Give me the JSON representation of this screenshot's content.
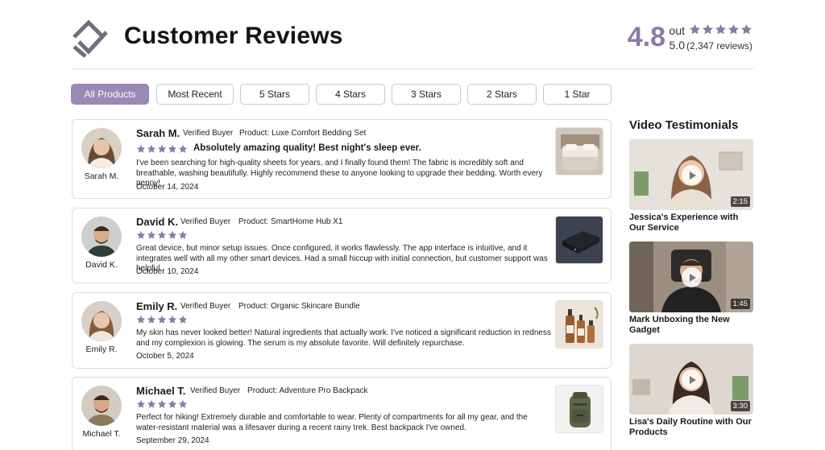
{
  "header": {
    "title": "Customer Reviews",
    "rating": "4.8",
    "rating_out": "out",
    "rating_of": "5.0",
    "rating_count": "(2,347 reviews)",
    "accent_color": "#8c7aa8"
  },
  "filters": [
    "All Products",
    "Most Recent",
    "5 Stars",
    "4 Stars",
    "3 Stars",
    "2 Stars",
    "1 Star"
  ],
  "active_filter": "All Products",
  "reviews": [
    {
      "name": "Sarah M.",
      "avatar_label": "Sarah M.",
      "verified": "Verified Buyer",
      "product": "Product: Luxe Comfort Bedding Set",
      "stars": 5,
      "headline": "Absolutely amazing quality! Best night's sleep ever.",
      "body": "I've been searching for high-quality sheets for years, and I finally found them! The fabric is incredibly soft and breathable, washing beautifully. Highly recommend these to anyone looking to upgrade their bedding. Worth every penny!",
      "date": "October 14, 2024",
      "thumb_icon": "bedding-image"
    },
    {
      "name": "David K.",
      "avatar_label": "David K.",
      "verified": "Verified Buyer",
      "product": "Product: SmartHome Hub X1",
      "stars": 5,
      "headline": "",
      "body": "Great device, but minor setup issues. Once configured, it works flawlessly. The app interface is intuitive, and it integrates well with all my other smart devices. Had a small hiccup with initial connection, but customer support was helpful.",
      "date": "October 10, 2024",
      "thumb_icon": "smart-hub-image"
    },
    {
      "name": "Emily R.",
      "avatar_label": "Emily R.",
      "verified": "Verified Buyer",
      "product": "Product: Organic Skincare Bundle",
      "stars": 5,
      "headline": "",
      "body": "My skin has never looked better! Natural ingredients that actually work. I've noticed a significant reduction in redness and my complexion is glowing. The serum is my absolute favorite. Will definitely repurchase.",
      "date": "October 5, 2024",
      "thumb_icon": "skincare-bottles-image"
    },
    {
      "name": "Michael T.",
      "avatar_label": "Michael T.",
      "verified": "Verified Buyer",
      "product": "Product: Adventure Pro Backpack",
      "stars": 5,
      "headline": "",
      "body": "Perfect for hiking! Extremely durable and comfortable to wear. Plenty of compartments for all my gear, and the water-resistant material was a lifesaver during a recent rainy trek. Best backpack I've owned.",
      "date": "September 29, 2024",
      "thumb_icon": "backpack-image"
    }
  ],
  "videos": {
    "heading": "Video Testimonials",
    "items": [
      {
        "title": "Jessica's Experience with Our Service",
        "duration": "2:15"
      },
      {
        "title": "Mark Unboxing the New Gadget",
        "duration": "1:45"
      },
      {
        "title": "Lisa's Daily Routine with Our Products",
        "duration": "3:30"
      }
    ]
  },
  "colors": {
    "star": "#8c7aa8",
    "active_filter_bg": "#9a88b5"
  }
}
